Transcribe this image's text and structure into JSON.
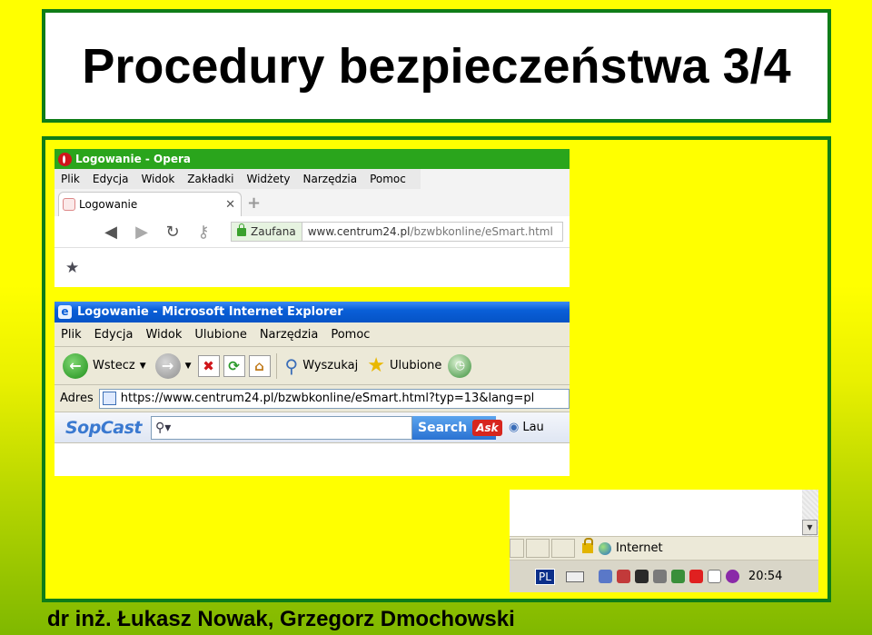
{
  "slide": {
    "title": "Procedury bezpieczeństwa 3/4",
    "footer": "dr inż. Łukasz Nowak, Grzegorz Dmochowski"
  },
  "opera": {
    "window_title": "Logowanie - Opera",
    "menu": [
      "Plik",
      "Edycja",
      "Widok",
      "Zakładki",
      "Widżety",
      "Narzędzia",
      "Pomoc"
    ],
    "tab_label": "Logowanie",
    "tab_close": "✕",
    "new_tab": "+",
    "trust_label": "Zaufana",
    "url_host": "www.centrum24.pl",
    "url_path": "/bzwbkonline/eSmart.html"
  },
  "ie": {
    "window_title": "Logowanie - Microsoft Internet Explorer",
    "menu": [
      "Plik",
      "Edycja",
      "Widok",
      "Ulubione",
      "Narzędzia",
      "Pomoc"
    ],
    "back_label": "Wstecz",
    "search_label": "Wyszukaj",
    "favorites_label": "Ulubione",
    "address_label": "Adres",
    "url": "https://www.centrum24.pl/bzwbkonline/eSmart.html?typ=13&lang=pl",
    "sopcast_logo": "SopCast",
    "search_button": "Search",
    "ask_logo": "Ask",
    "launch_label": "Lau"
  },
  "taskbar": {
    "zone_label": "Internet",
    "lang": "PL",
    "clock": "20:54"
  },
  "colors": {
    "slide_border": "#0f7d18",
    "background_top": "#ffff00",
    "opera_titlebar": "#2aa51c",
    "ie_titlebar": "#0a5fd8"
  }
}
